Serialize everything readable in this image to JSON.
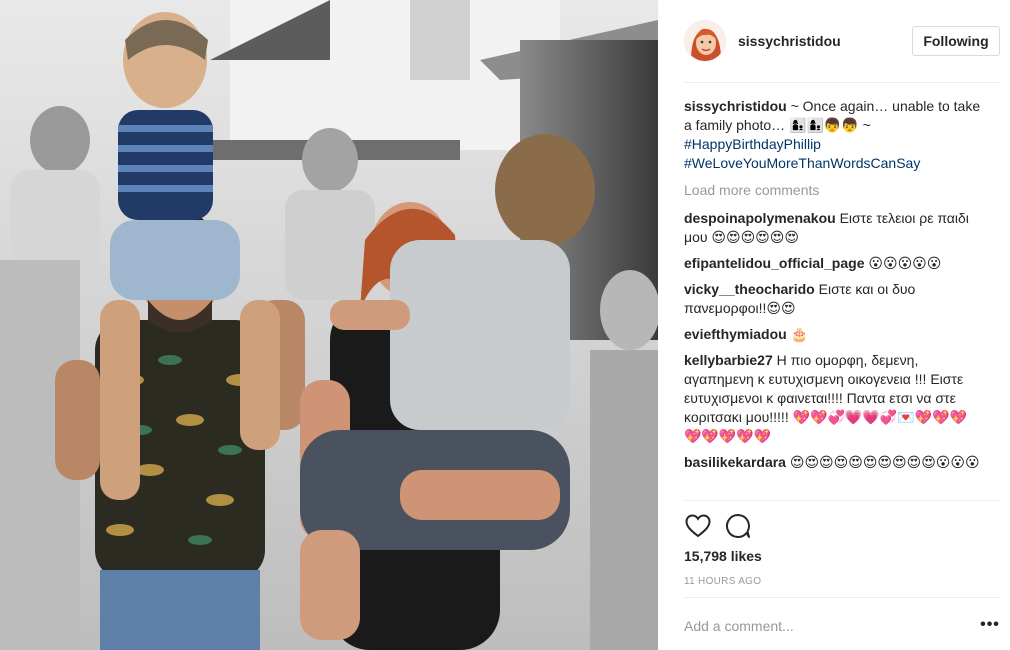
{
  "post": {
    "username": "sissychristidou",
    "follow_label": "Following"
  },
  "caption": {
    "username": "sissychristidou",
    "text": "~ Once again… unable to take a family photo… 👩‍👦👩‍👦👦👦 ~",
    "hashtags": [
      "#HappyBirthdayPhillip",
      "#WeLoveYouMoreThanWordsCanSay"
    ]
  },
  "load_more_label": "Load more comments",
  "comments": [
    {
      "user": "despoinapolymenakou",
      "text": "Ειστε τελειοι ρε παιδι μου 😍😍😍😍😍😍"
    },
    {
      "user": "efipantelidou_official_page",
      "text": "😮😮😮😮😮"
    },
    {
      "user": "vicky__theocharido",
      "text": "Ειστε και οι δυο πανεμορφοι!!😍😍"
    },
    {
      "user": "eviefthymiadou",
      "text": "🎂"
    },
    {
      "user": "kellybarbie27",
      "text": "Η πιο ομορφη, δεμενη, αγαπημενη κ ευτυχισμενη οικογενεια !!! Ειστε ευτυχισμενοι κ φαινεται!!!! Παντα ετσι να στε κοριτσακι μου!!!!! 💖💖💞💗💗💞💌💖💖💖💖💖💖💖💖"
    },
    {
      "user": "basilikekardara",
      "text": "😍😍😍😍😍😍😍😍😍😍😮😮😮"
    }
  ],
  "likes": "15,798 likes",
  "timestamp": "11 HOURS AGO",
  "add_comment_placeholder": "Add a comment...",
  "more_options": "•••",
  "icons": {
    "like": "heart-icon",
    "comment": "comment-bubble-icon"
  }
}
